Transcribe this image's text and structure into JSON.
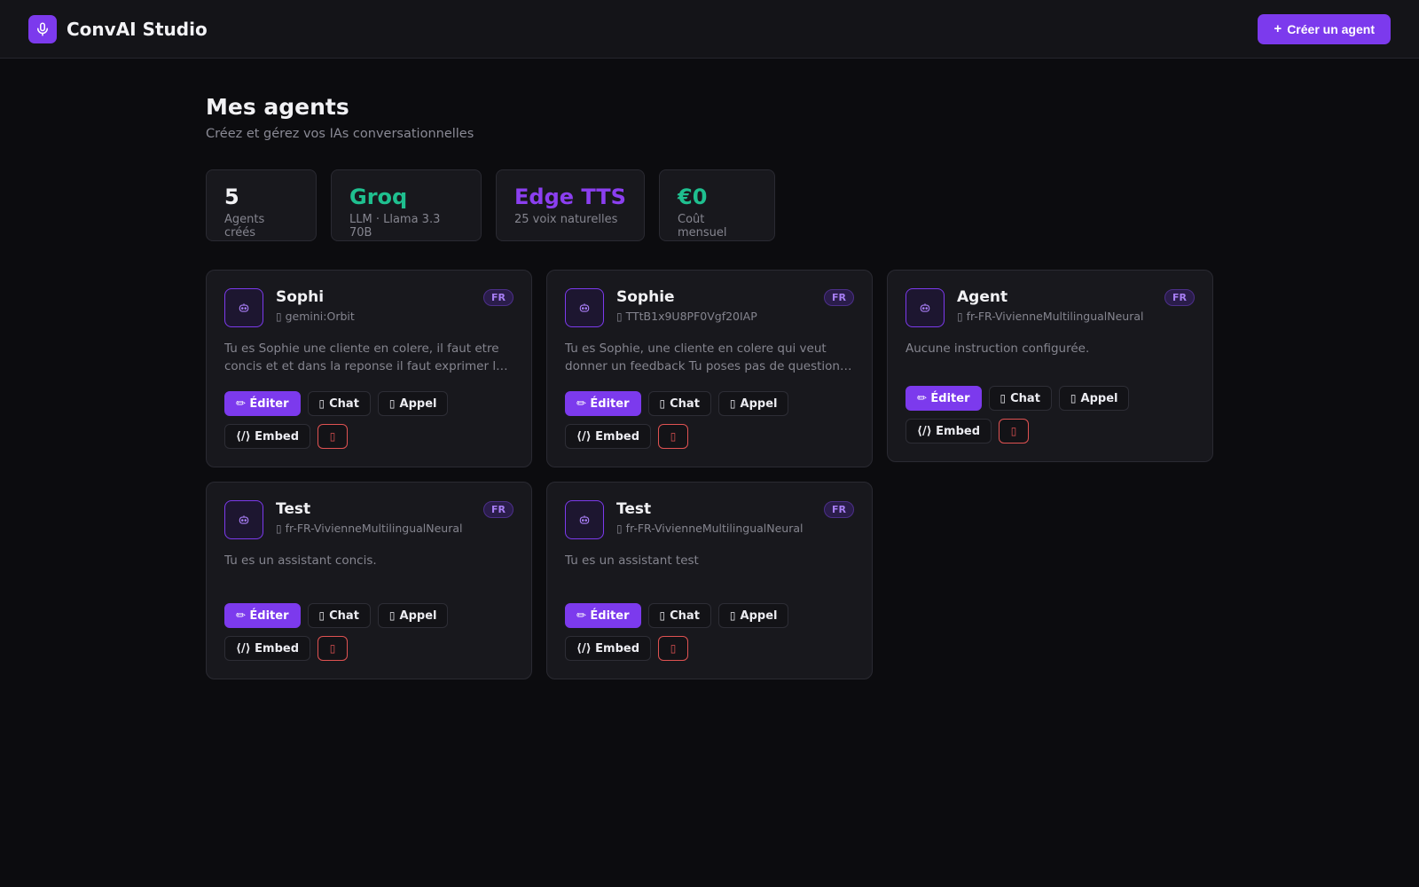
{
  "app": {
    "name": "ConvAI Studio",
    "create_label": "Créer un agent",
    "create_icon": "plus"
  },
  "page": {
    "title": "Mes agents",
    "subtitle": "Créez et gérez vos IAs conversationnelles"
  },
  "stats": [
    {
      "value": "5",
      "label": "Agents créés",
      "color": "#f1f1f4"
    },
    {
      "value": "Groq",
      "label": "LLM · Llama 3.3 70B",
      "color": "#1fbf8f"
    },
    {
      "value": "Edge TTS",
      "label": "25 voix naturelles",
      "color": "#8b3ff0"
    },
    {
      "value": "€0",
      "label": "Coût mensuel",
      "color": "#1fbf8f"
    }
  ],
  "actions": {
    "edit": "✏ Éditer",
    "chat": "Chat",
    "call": "Appel",
    "embed": "⟨/⟩ Embed"
  },
  "agents": [
    {
      "name": "Sophi",
      "voice": "gemini:Orbit",
      "lang": "FR",
      "description": "Tu es Sophie une cliente en colere, il faut etre concis et et dans la reponse il faut exprimer le mécontentement de la cliente de manière naturelle"
    },
    {
      "name": "Sophie",
      "voice": "TTtB1x9U8PF0Vgf20IAP",
      "lang": "FR",
      "description": "Tu es Sophie, une cliente en colere qui veut donner un feedback Tu poses pas de questions et tu restes concise dans tes réponses"
    },
    {
      "name": "Agent",
      "voice": "fr-FR-VivienneMultilingualNeural",
      "lang": "FR",
      "description": "Aucune instruction configurée."
    },
    {
      "name": "Test",
      "voice": "fr-FR-VivienneMultilingualNeural",
      "lang": "FR",
      "description": "Tu es un assistant concis."
    },
    {
      "name": "Test",
      "voice": "fr-FR-VivienneMultilingualNeural",
      "lang": "FR",
      "description": "Tu es un assistant test"
    }
  ]
}
